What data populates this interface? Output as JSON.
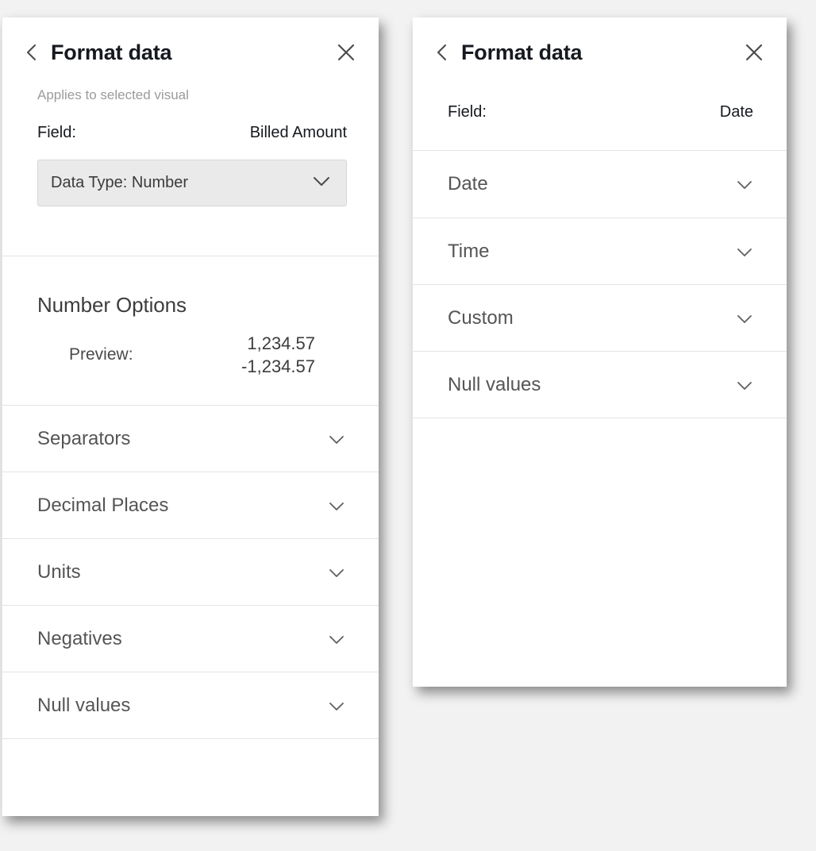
{
  "background_color": "#f2f2f2",
  "number_panel": {
    "title": "Format data",
    "back_icon": "chevron-left-icon",
    "close_icon": "close-icon",
    "applies_to": "Applies to selected visual",
    "field_label": "Field:",
    "field_value": "Billed Amount",
    "data_type_select": {
      "label": "Data Type: Number",
      "chevron_icon": "chevron-down-icon"
    },
    "section_title": "Number Options",
    "preview_label": "Preview:",
    "preview_positive": "1,234.57",
    "preview_negative": "-1,234.57",
    "rows": [
      {
        "label": "Separators",
        "chevron_icon": "chevron-down-icon"
      },
      {
        "label": "Decimal Places",
        "chevron_icon": "chevron-down-icon"
      },
      {
        "label": "Units",
        "chevron_icon": "chevron-down-icon"
      },
      {
        "label": "Negatives",
        "chevron_icon": "chevron-down-icon"
      },
      {
        "label": "Null values",
        "chevron_icon": "chevron-down-icon"
      }
    ]
  },
  "date_panel": {
    "title": "Format data",
    "back_icon": "chevron-left-icon",
    "close_icon": "close-icon",
    "field_label": "Field:",
    "field_value": "Date",
    "rows": [
      {
        "label": "Date",
        "chevron_icon": "chevron-down-icon"
      },
      {
        "label": "Time",
        "chevron_icon": "chevron-down-icon"
      },
      {
        "label": "Custom",
        "chevron_icon": "chevron-down-icon"
      },
      {
        "label": "Null values",
        "chevron_icon": "chevron-down-icon"
      }
    ]
  },
  "colors": {
    "panel_bg": "#ffffff",
    "divider": "#e4e4e4",
    "title_text": "#16191f",
    "muted_text": "#9b9b9b",
    "row_text": "#555555",
    "select_bg": "#eaeaea"
  }
}
